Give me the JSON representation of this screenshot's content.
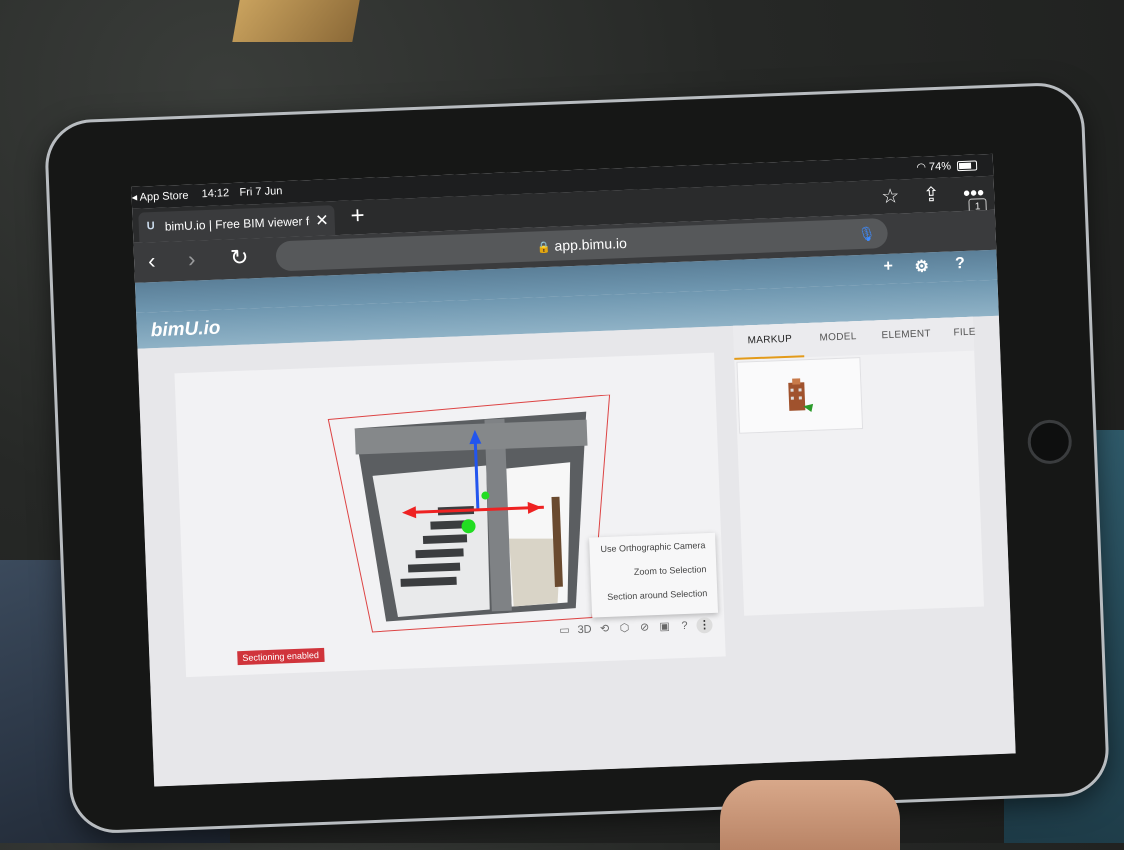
{
  "status_bar": {
    "back_app": "◂ App Store",
    "time": "14:12",
    "date": "Fri 7 Jun",
    "battery": "74%",
    "wifi_icon": "wifi-icon"
  },
  "browser": {
    "tab_title": "bimU.io | Free BIM viewer fo",
    "tab_favicon": "U",
    "tab_count": "1",
    "url": "app.bimu.io"
  },
  "app": {
    "logo": "bimU.io",
    "header_icons": [
      "plus-icon",
      "gear-icon",
      "help-icon"
    ]
  },
  "viewer": {
    "context_menu": [
      "Use Orthographic Camera",
      "Zoom to Selection",
      "Section around Selection"
    ],
    "toolbar_icons": [
      "image-icon",
      "3d-icon",
      "orbit-icon",
      "cube-icon",
      "hide-icon",
      "frame-icon",
      "help-icon",
      "more-icon"
    ],
    "toolbar_glyphs": [
      "▭",
      "3D",
      "⟲",
      "⬡",
      "⊘",
      "▣",
      "?",
      "⋮"
    ],
    "section_badge": "Sectioning enabled"
  },
  "panel": {
    "tabs": [
      "MARKUP",
      "MODEL",
      "ELEMENT",
      "FILE"
    ],
    "active_tab": "MARKUP"
  },
  "colors": {
    "app_header": "#6f97b0",
    "active_tab_accent": "#e39b1a",
    "badge": "#d0343b"
  }
}
